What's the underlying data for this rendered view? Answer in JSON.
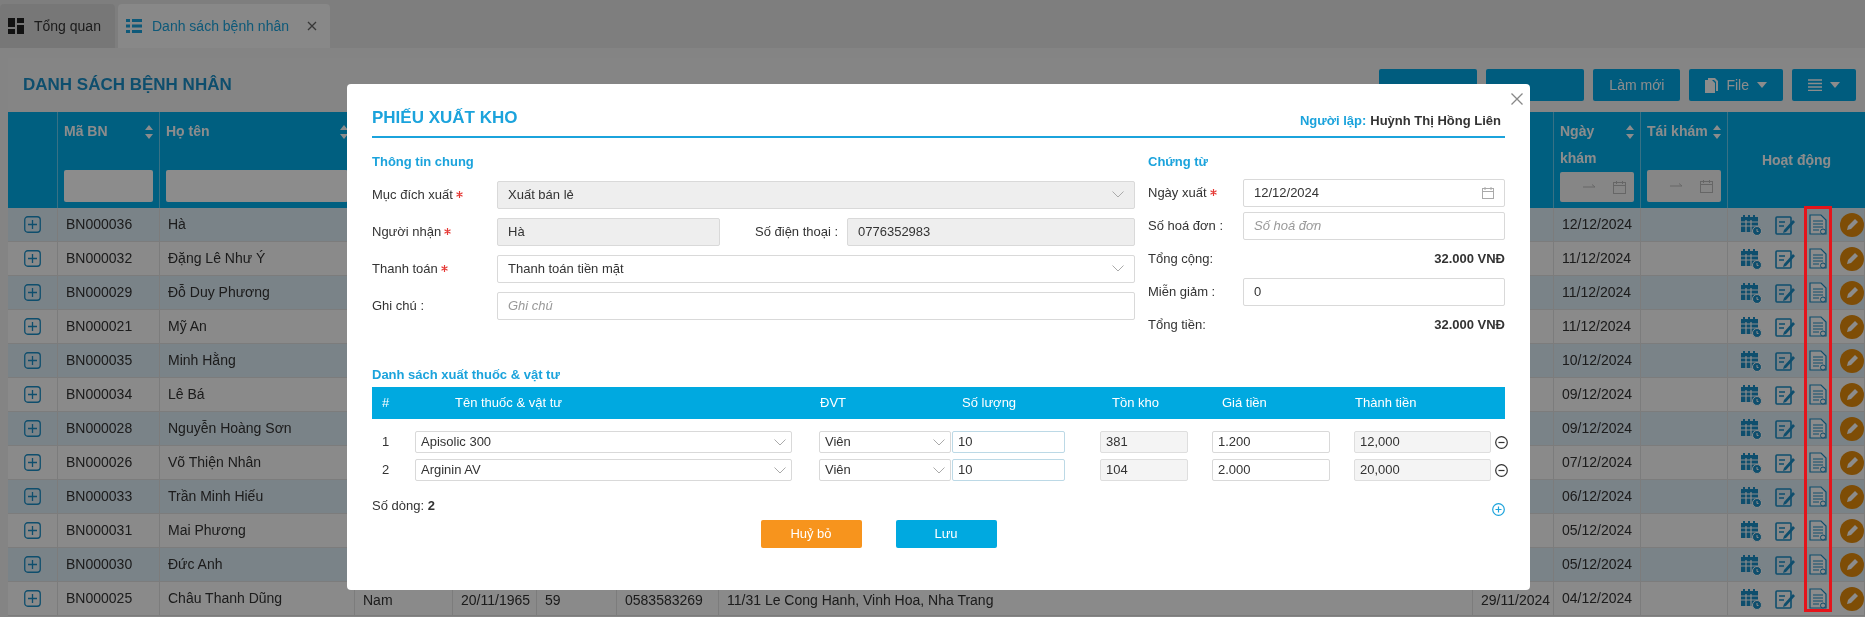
{
  "tabs": [
    {
      "label": "Tổng quan",
      "selected": false,
      "closable": false
    },
    {
      "label": "Danh sách bệnh nhân",
      "selected": true,
      "closable": true
    }
  ],
  "page": {
    "title": "DANH SÁCH BỆNH NHÂN",
    "toolbar": [
      {
        "kind": "button"
      },
      {
        "kind": "button"
      },
      {
        "label": "Làm mới",
        "kind": "button"
      },
      {
        "label": "File",
        "kind": "file_menu"
      },
      {
        "kind": "view_menu"
      }
    ],
    "table": {
      "columns": [
        {
          "label": "Mã BN",
          "sortable": true
        },
        {
          "label": "Họ tên",
          "sortable": true
        },
        {
          "label": "Ngày khám",
          "sortable": true
        },
        {
          "label": "Tái khám",
          "sortable": true
        },
        {
          "label": "Hoạt động",
          "sortable": false
        }
      ],
      "rows": [
        {
          "code": "BN000036",
          "name": "Hà",
          "exam_date": "12/12/2024"
        },
        {
          "code": "BN000032",
          "name": "Đặng Lê Như Ý",
          "exam_date": "11/12/2024"
        },
        {
          "code": "BN000029",
          "name": "Đỗ Duy Phương",
          "exam_date": "11/12/2024"
        },
        {
          "code": "BN000021",
          "name": "Mỹ An",
          "exam_date": "11/12/2024"
        },
        {
          "code": "BN000035",
          "name": "Minh Hằng",
          "exam_date": "10/12/2024"
        },
        {
          "code": "BN000034",
          "name": "Lê Bá",
          "exam_date": "09/12/2024"
        },
        {
          "code": "BN000028",
          "name": "Nguyễn Hoàng Sơn",
          "exam_date": "09/12/2024"
        },
        {
          "code": "BN000026",
          "name": "Võ Thiện Nhân",
          "exam_date": "07/12/2024"
        },
        {
          "code": "BN000033",
          "name": "Trần Minh Hiếu",
          "exam_date": "06/12/2024"
        },
        {
          "code": "BN000031",
          "name": "Mai Phương",
          "exam_date": "05/12/2024"
        },
        {
          "code": "BN000030",
          "name": "Đức Anh",
          "exam_date": "05/12/2024"
        },
        {
          "code": "BN000025",
          "name": "Châu Thanh Dũng",
          "exam_date": "04/12/2024",
          "details": [
            "Nam",
            "20/11/1965",
            "59",
            "0583583269",
            "11/31 Le Cong Hanh, Vinh Hoa, Nha Trang",
            "29/11/2024"
          ]
        }
      ]
    }
  },
  "modal": {
    "title": "PHIẾU XUẤT KHO",
    "creator_label": "Người lập:",
    "creator_name": "Huỳnh Thị Hồng Liên",
    "general": {
      "heading": "Thông tin chung",
      "fields": [
        {
          "label": "Mục đích xuất",
          "required": true,
          "kind": "select",
          "value": "Xuất bán lẻ",
          "readonly": true
        },
        {
          "label": "Người nhận",
          "required": true,
          "kind": "text",
          "value": "Hà",
          "readonly": true
        },
        {
          "label": "Số điện thoại :",
          "required": false,
          "kind": "text",
          "value": "0776352983",
          "readonly": true
        },
        {
          "label": "Thanh toán",
          "required": true,
          "kind": "select",
          "value": "Thanh toán tiền mặt",
          "readonly": false
        },
        {
          "label": "Ghi chú :",
          "required": false,
          "kind": "text",
          "placeholder": "Ghi chú",
          "readonly": false
        }
      ]
    },
    "voucher": {
      "heading": "Chứng từ",
      "fields": [
        {
          "label": "Ngày xuất",
          "required": true,
          "kind": "date",
          "value": "12/12/2024"
        },
        {
          "label": "Số hoá đơn :",
          "required": false,
          "kind": "text",
          "placeholder": "Số hoá đơn"
        },
        {
          "label": "Tổng cộng:",
          "required": false,
          "kind": "total",
          "value": "32.000 VNĐ"
        },
        {
          "label": "Miễn giảm :",
          "required": false,
          "kind": "text",
          "value": "0"
        },
        {
          "label": "Tổng tiền:",
          "required": false,
          "kind": "total",
          "value": "32.000 VNĐ"
        }
      ]
    },
    "items": {
      "heading": "Danh sách xuất thuốc & vật tư",
      "columns": [
        "#",
        "Tên thuốc & vật tư",
        "ĐVT",
        "Số lượng",
        "Tồn kho",
        "Giá tiền",
        "Thành tiền"
      ],
      "rows": [
        {
          "index": "1",
          "name": "Apisolic 300",
          "unit": "Viên",
          "qty": "10",
          "stock": "381",
          "price": "1.200",
          "total": "12,000"
        },
        {
          "index": "2",
          "name": "Arginin AV",
          "unit": "Viên",
          "qty": "10",
          "stock": "104",
          "price": "2.000",
          "total": "20,000"
        }
      ],
      "count_label": "Số dòng:",
      "count": "2"
    },
    "buttons": [
      {
        "label": "Huỷ bỏ",
        "kind": "cancel"
      },
      {
        "label": "Lưu",
        "kind": "save"
      }
    ]
  }
}
